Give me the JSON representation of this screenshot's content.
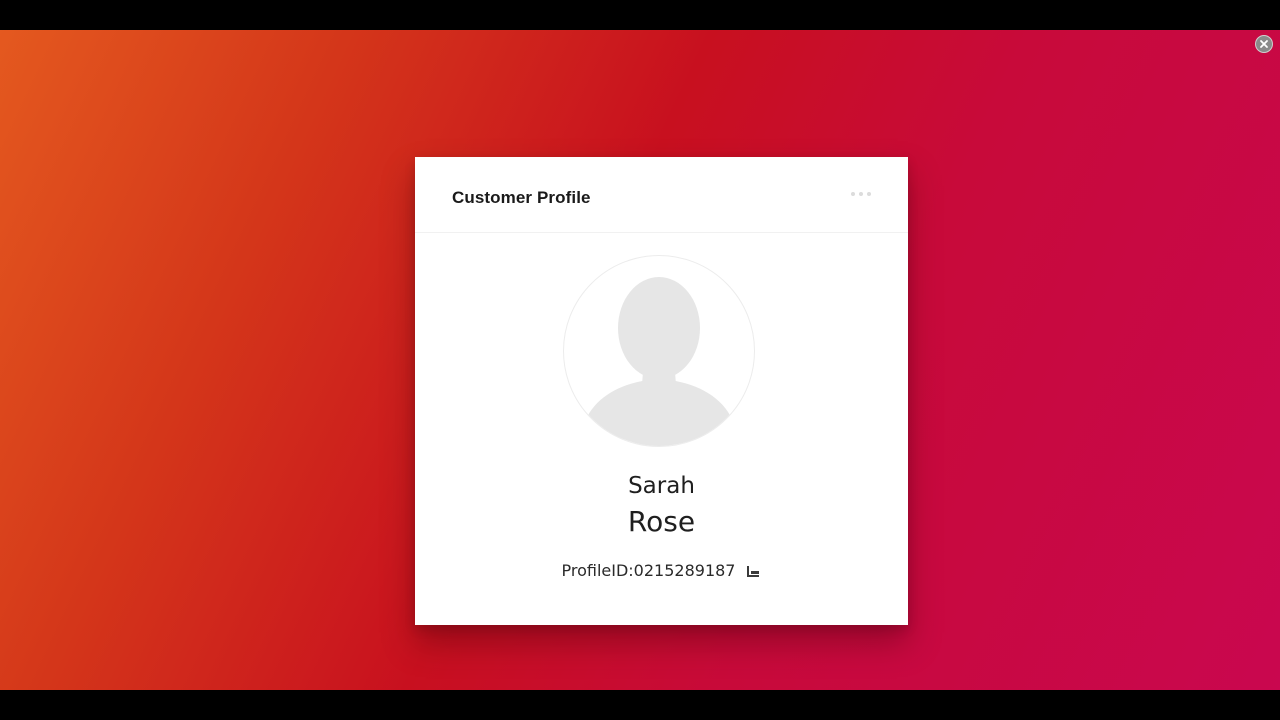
{
  "window": {
    "close_icon": "close-icon"
  },
  "card": {
    "title": "Customer Profile",
    "more_icon": "more-horizontal-icon",
    "avatar_icon": "person-silhouette-icon",
    "first_name": "Sarah",
    "last_name": "Rose",
    "profile_id": "ProfileID:0215289187",
    "copy_icon": "copy-icon"
  },
  "colors": {
    "background_gradient": [
      "#e4591f",
      "#c8101f",
      "#c9074f"
    ],
    "card_background": "#ffffff",
    "title_text": "#1a1a1a",
    "avatar_fill": "#e6e6e6"
  }
}
